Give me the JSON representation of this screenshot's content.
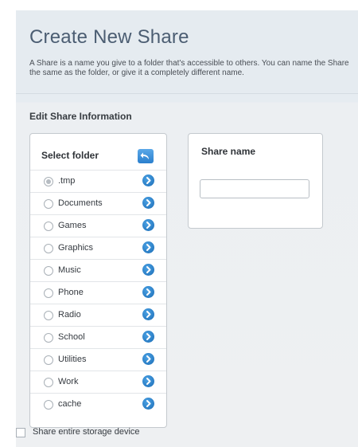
{
  "header": {
    "title": "Create New Share",
    "description": "A Share is a name you give to a folder that's accessible to others. You can name the Share the same as the folder, or give it a completely different name."
  },
  "section": {
    "title": "Edit Share Information"
  },
  "folder_panel": {
    "label": "Select folder",
    "back_icon": "back-arrow-icon",
    "selected_index": 0,
    "items": [
      {
        "label": ".tmp",
        "checked": true
      },
      {
        "label": "Documents",
        "checked": false
      },
      {
        "label": "Games",
        "checked": false
      },
      {
        "label": "Graphics",
        "checked": false
      },
      {
        "label": "Music",
        "checked": false
      },
      {
        "label": "Phone",
        "checked": false
      },
      {
        "label": "Radio",
        "checked": false
      },
      {
        "label": "School",
        "checked": false
      },
      {
        "label": "Utilities",
        "checked": false
      },
      {
        "label": "Work",
        "checked": false
      },
      {
        "label": "cache",
        "checked": false
      }
    ],
    "row_icon": "chevron-right-icon"
  },
  "share_panel": {
    "label": "Share name",
    "value": "",
    "placeholder": ""
  },
  "entire_device": {
    "label": "Share entire storage device",
    "checked": false
  },
  "colors": {
    "accent": "#2a7fcd",
    "header_bg": "#e5ebf0",
    "title": "#4b5d72"
  }
}
